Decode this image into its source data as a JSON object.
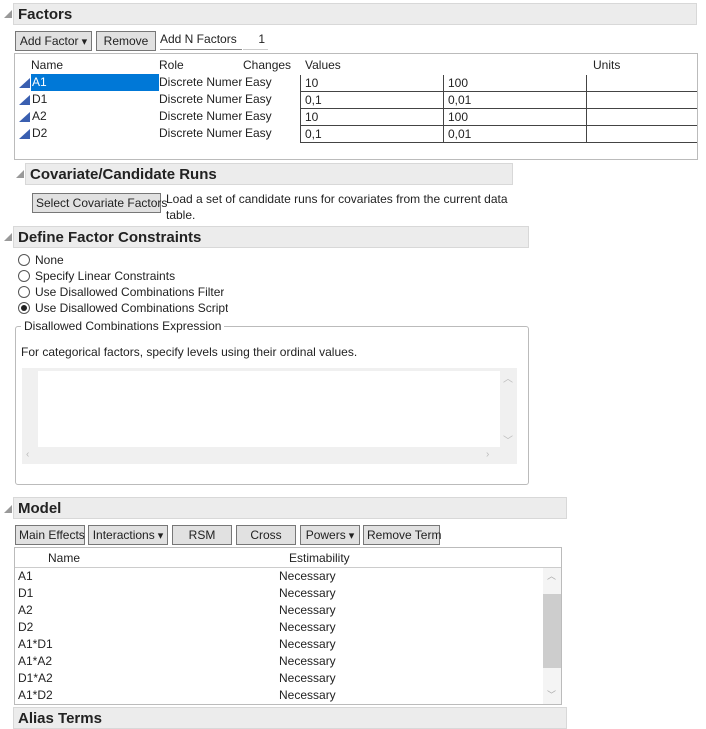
{
  "factors": {
    "title": "Factors",
    "add_factor": "Add Factor",
    "remove": "Remove",
    "add_n_label": "Add N Factors",
    "add_n_value": "1",
    "headers": {
      "name": "Name",
      "role": "Role",
      "changes": "Changes",
      "values": "Values",
      "units": "Units"
    },
    "rows": [
      {
        "name": "A1",
        "role": "Discrete Numeric",
        "changes": "Easy",
        "v1": "10",
        "v2": "100",
        "units": ""
      },
      {
        "name": "D1",
        "role": "Discrete Numeric",
        "changes": "Easy",
        "v1": "0,1",
        "v2": "0,01",
        "units": ""
      },
      {
        "name": "A2",
        "role": "Discrete Numeric",
        "changes": "Easy",
        "v1": "10",
        "v2": "100",
        "units": ""
      },
      {
        "name": "D2",
        "role": "Discrete Numeric",
        "changes": "Easy",
        "v1": "0,1",
        "v2": "0,01",
        "units": ""
      }
    ]
  },
  "covariate": {
    "title": "Covariate/Candidate Runs",
    "button": "Select Covariate Factors",
    "description": "Load a set of candidate runs for covariates from the current data table."
  },
  "constraints": {
    "title": "Define Factor Constraints",
    "options": [
      "None",
      "Specify Linear Constraints",
      "Use Disallowed Combinations Filter",
      "Use Disallowed Combinations Script"
    ],
    "selected": 3,
    "group_title": "Disallowed Combinations Expression",
    "hint": "For categorical factors, specify levels using their ordinal values.",
    "script": ""
  },
  "model": {
    "title": "Model",
    "buttons": {
      "main_effects": "Main Effects",
      "interactions": "Interactions",
      "rsm": "RSM",
      "cross": "Cross",
      "powers": "Powers",
      "remove_term": "Remove Term"
    },
    "headers": {
      "name": "Name",
      "estimability": "Estimability"
    },
    "rows": [
      {
        "name": "A1",
        "est": "Necessary"
      },
      {
        "name": "D1",
        "est": "Necessary"
      },
      {
        "name": "A2",
        "est": "Necessary"
      },
      {
        "name": "D2",
        "est": "Necessary"
      },
      {
        "name": "A1*D1",
        "est": "Necessary"
      },
      {
        "name": "A1*A2",
        "est": "Necessary"
      },
      {
        "name": "D1*A2",
        "est": "Necessary"
      },
      {
        "name": "A1*D2",
        "est": "Necessary"
      }
    ]
  },
  "alias": {
    "title": "Alias Terms"
  }
}
